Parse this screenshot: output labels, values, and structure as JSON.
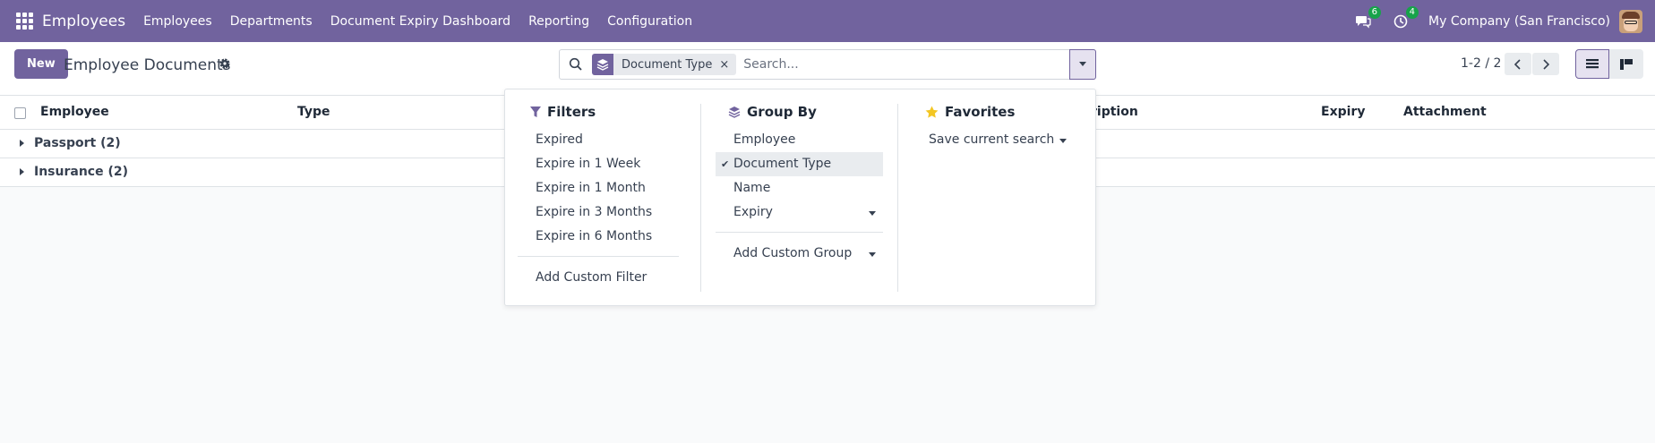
{
  "navbar": {
    "brand": "Employees",
    "menu": [
      "Employees",
      "Departments",
      "Document Expiry Dashboard",
      "Reporting",
      "Configuration"
    ],
    "messages_badge": "6",
    "activities_badge": "4",
    "company": "My Company (San Francisco)"
  },
  "control": {
    "new_label": "New",
    "title": "Employee Documents",
    "search": {
      "facet_label": "Document Type",
      "facet_remove": "×",
      "placeholder": "Search..."
    },
    "pager": "1-2 / 2"
  },
  "list": {
    "columns": [
      "Employee",
      "Type",
      "Description",
      "Expiry",
      "Attachment"
    ],
    "column_visible": [
      "Employee",
      "Type",
      "ription",
      "Expiry",
      "Attachment"
    ],
    "groups": [
      {
        "label": "Passport (2)"
      },
      {
        "label": "Insurance (2)"
      }
    ]
  },
  "dropdown": {
    "filters": {
      "title": "Filters",
      "items": [
        "Expired",
        "Expire in 1 Week",
        "Expire in 1 Month",
        "Expire in 3 Months",
        "Expire in 6 Months"
      ],
      "custom": "Add Custom Filter"
    },
    "group_by": {
      "title": "Group By",
      "items": [
        "Employee",
        "Document Type",
        "Name",
        "Expiry"
      ],
      "selected": "Document Type",
      "custom": "Add Custom Group"
    },
    "favorites": {
      "title": "Favorites",
      "save": "Save current search"
    }
  },
  "colors": {
    "brand": "#71639e",
    "badge": "#17a34a",
    "favorite_star": "#f3c623"
  }
}
